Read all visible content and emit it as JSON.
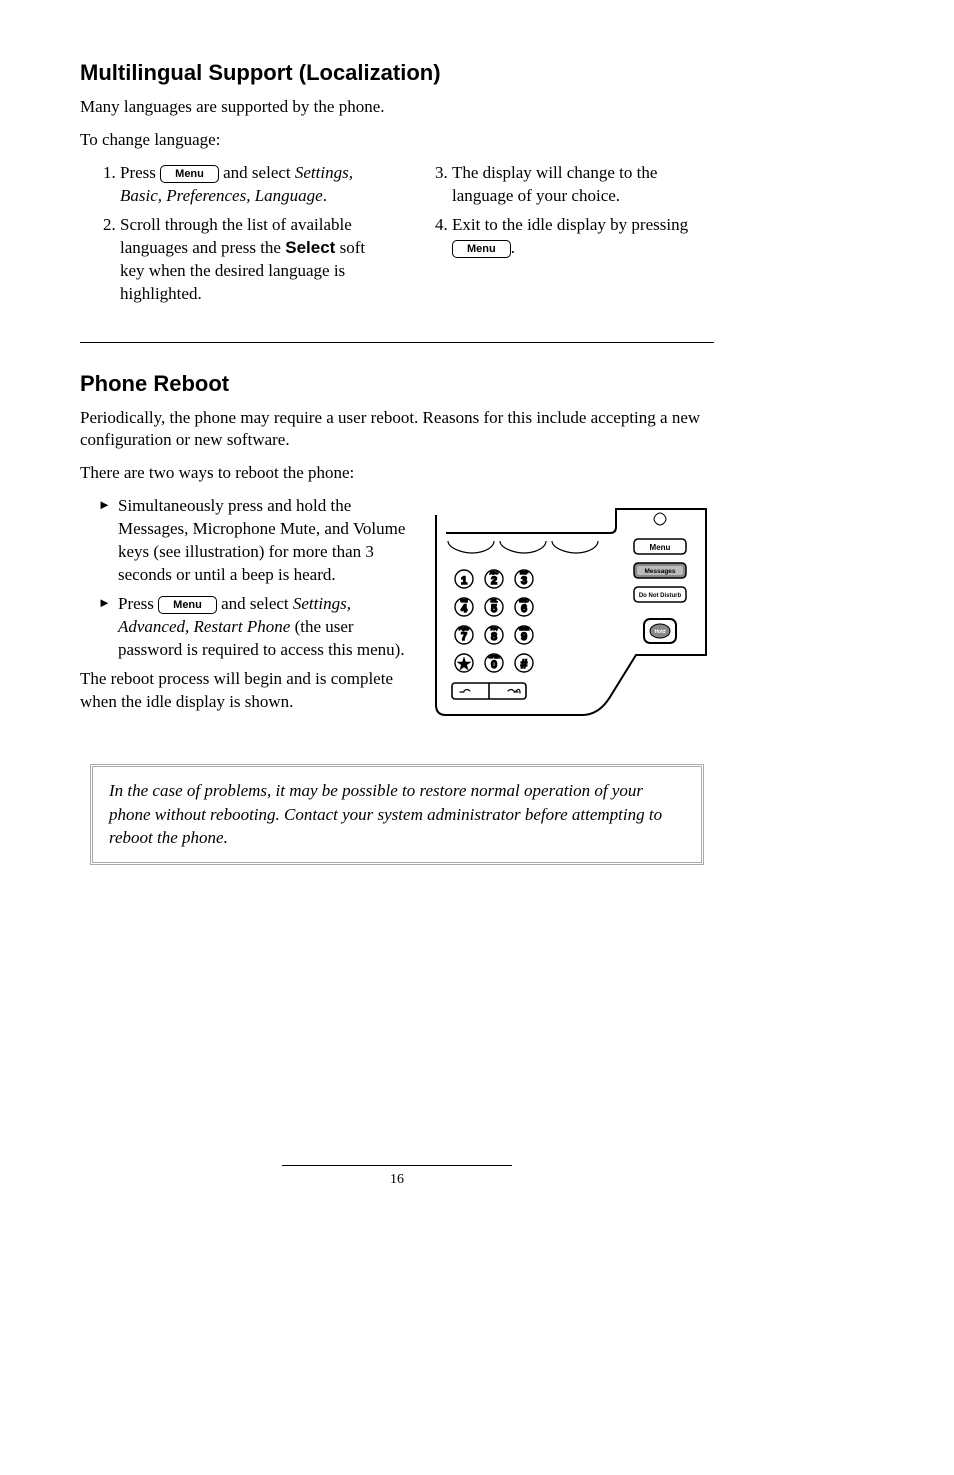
{
  "section1": {
    "title": "Multilingual Support (Localization)",
    "intro1": "Many languages are supported by the phone.",
    "intro2": "To change language:",
    "left_steps": [
      {
        "pre": "Press ",
        "btn": "Menu",
        "post": " and select ",
        "em1": "Settings, Basic, Preferences, Language",
        "tail": "."
      },
      {
        "pre": "Scroll through the list of available languages and press the ",
        "bold": "Select",
        "post": " soft key when the desired language is highlighted."
      }
    ],
    "right_steps": [
      {
        "text": "The display will change to the language of your choice."
      },
      {
        "pre": "Exit to the idle display by pressing ",
        "btn": "Menu",
        "tail": "."
      }
    ]
  },
  "section2": {
    "title": "Phone Reboot",
    "intro1": "Periodically, the phone may require a user reboot.  Reasons for this include accepting a new configuration or new software.",
    "intro2": "There are two ways to reboot the phone:",
    "bullets": [
      {
        "text": "Simultaneously press and hold the Messages, Microphone Mute, and Volume keys (see illustration) for more than 3 seconds or until a beep is heard."
      },
      {
        "pre": "Press ",
        "btn": "Menu",
        "post": " and select ",
        "em1": "Settings, Advanced, Restart Phone",
        "mid": " (the user password is required to access this menu)."
      }
    ],
    "outro": "The reboot process will begin and is complete when the idle display is shown."
  },
  "note": "In the case of problems, it may be possible to restore normal operation of your phone without rebooting.  Contact your system administrator before attempting to reboot the phone.",
  "page_number": "16",
  "phone": {
    "side_keys": [
      "Menu",
      "Messages",
      "Do Not Disturb",
      "Hold"
    ]
  }
}
